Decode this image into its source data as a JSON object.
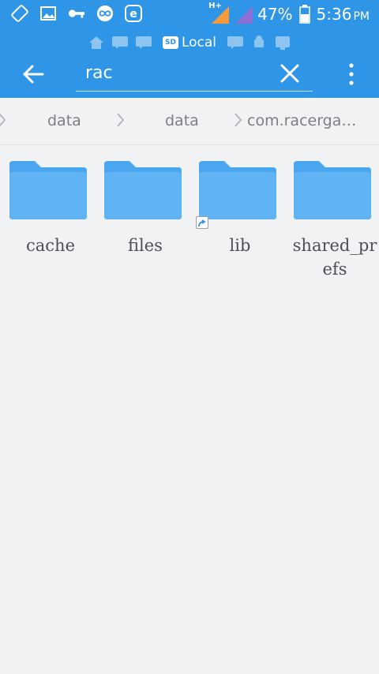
{
  "status_bar": {
    "battery": "47%",
    "time": "5:36",
    "time_suffix": "PM",
    "network_label": "H+",
    "icons": [
      "screen-rotation-icon",
      "image-icon",
      "key-icon",
      "infinity-icon",
      "e-app-icon",
      "signal-icon",
      "signal-icon-2",
      "battery-icon"
    ]
  },
  "window_strip": {
    "active_label": "Local",
    "active_badge": "SD"
  },
  "header": {
    "search_value": "rac",
    "accent": "#2f95e6"
  },
  "breadcrumb": {
    "items": [
      "data",
      "data",
      "com.racerga…"
    ]
  },
  "folders": [
    {
      "name": "cache"
    },
    {
      "name": "files"
    },
    {
      "name": "lib",
      "symlink": true
    },
    {
      "name": "shared_prefs"
    }
  ],
  "colors": {
    "folder": "#60b4f4",
    "folder_back": "#4aa6ef",
    "background": "#f1f2f4"
  }
}
